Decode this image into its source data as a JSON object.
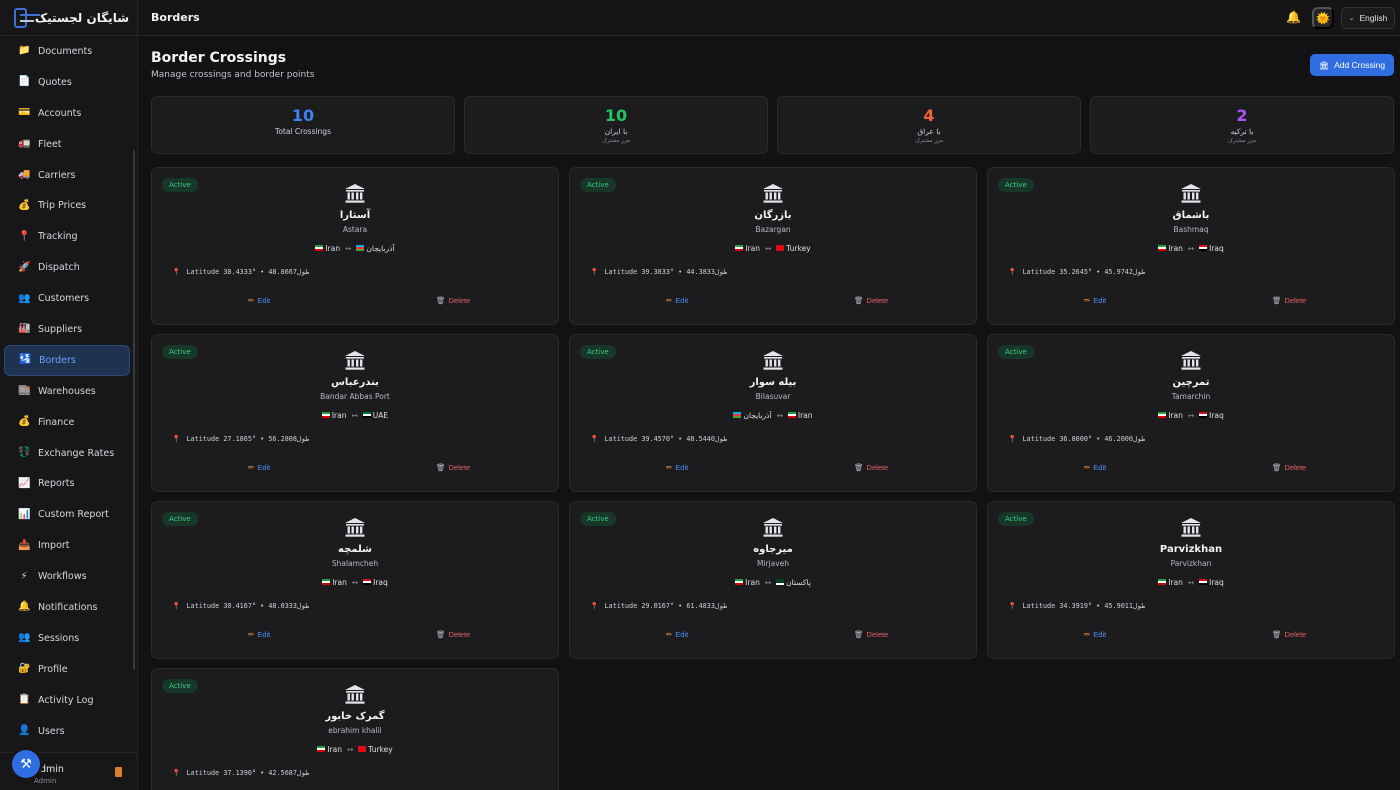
{
  "app": {
    "logo_text": "شایگان لجستیک"
  },
  "topbar": {
    "title": "Borders",
    "language": "English"
  },
  "sidebar": {
    "items": [
      {
        "label": "Documents",
        "icon": "folder-icon",
        "glyph": "📁"
      },
      {
        "label": "Quotes",
        "icon": "document-icon",
        "glyph": "📄"
      },
      {
        "label": "Accounts",
        "icon": "card-icon",
        "glyph": "💳"
      },
      {
        "label": "Fleet",
        "icon": "truck-icon",
        "glyph": "🚛"
      },
      {
        "label": "Carriers",
        "icon": "carrier-truck-icon",
        "glyph": "🚚"
      },
      {
        "label": "Trip Prices",
        "icon": "money-bag-icon",
        "glyph": "💰"
      },
      {
        "label": "Tracking",
        "icon": "pin-icon",
        "glyph": "📍"
      },
      {
        "label": "Dispatch",
        "icon": "rocket-icon",
        "glyph": "🚀"
      },
      {
        "label": "Customers",
        "icon": "people-icon",
        "glyph": "👥"
      },
      {
        "label": "Suppliers",
        "icon": "factory-icon",
        "glyph": "🏭"
      },
      {
        "label": "Borders",
        "icon": "passport-control-icon",
        "glyph": "🛂",
        "active": true
      },
      {
        "label": "Warehouses",
        "icon": "warehouse-icon",
        "glyph": "🏬"
      },
      {
        "label": "Finance",
        "icon": "coin-bag-icon",
        "glyph": "💰"
      },
      {
        "label": "Exchange Rates",
        "icon": "exchange-icon",
        "glyph": "💱"
      },
      {
        "label": "Reports",
        "icon": "chart-icon",
        "glyph": "📈"
      },
      {
        "label": "Custom Report",
        "icon": "bar-chart-icon",
        "glyph": "📊"
      },
      {
        "label": "Import",
        "icon": "inbox-icon",
        "glyph": "📥"
      },
      {
        "label": "Workflows",
        "icon": "lightning-icon",
        "glyph": "⚡"
      },
      {
        "label": "Notifications",
        "icon": "bell-icon",
        "glyph": "🔔"
      },
      {
        "label": "Sessions",
        "icon": "people-icon",
        "glyph": "👥"
      },
      {
        "label": "Profile",
        "icon": "lock-icon",
        "glyph": "🔐"
      },
      {
        "label": "Activity Log",
        "icon": "log-icon",
        "glyph": "📋"
      },
      {
        "label": "Users",
        "icon": "user-icon",
        "glyph": "👤"
      }
    ],
    "user": {
      "name": "dmin",
      "role": "Admin"
    }
  },
  "page": {
    "title": "Border Crossings",
    "subtitle": "Manage crossings and border points",
    "add_label": "Add Crossing"
  },
  "stats": [
    {
      "value": "10",
      "label": "Total Crossings",
      "sub": "",
      "color": "#3b82f6"
    },
    {
      "value": "10",
      "label": "با ایران",
      "sub": "مرز مشترک",
      "color": "#22c55e"
    },
    {
      "value": "4",
      "label": "با عراق",
      "sub": "مرز مشترک",
      "color": "#f0643c"
    },
    {
      "value": "2",
      "label": "با ترکیه",
      "sub": "مرز مشترک",
      "color": "#a855f7"
    }
  ],
  "card_labels": {
    "status": "Active",
    "edit": "Edit",
    "delete": "Delete",
    "arrow": "↔",
    "lat_prefix": "Latitude",
    "lon_suffix": "طول"
  },
  "crossings": [
    {
      "name_fa": "آستارا",
      "name_en": "Astara",
      "from": "Iran",
      "to": "آذربایجان",
      "lat": "38.4333°",
      "lon": "48.8667"
    },
    {
      "name_fa": "بازرگان",
      "name_en": "Bazargan",
      "from": "Iran",
      "to": "Turkey",
      "lat": "39.3833°",
      "lon": "44.3833"
    },
    {
      "name_fa": "باشماق",
      "name_en": "Bashmaq",
      "from": "Iran",
      "to": "Iraq",
      "lat": "35.2645°",
      "lon": "45.9742"
    },
    {
      "name_fa": "بندرعباس",
      "name_en": "Bandar Abbas Port",
      "from": "Iran",
      "to": "UAE",
      "lat": "27.1865°",
      "lon": "56.2808"
    },
    {
      "name_fa": "بیله سوار",
      "name_en": "Bilasuvar",
      "from": "آذربایجان",
      "to": "Iran",
      "lat": "39.4570°",
      "lon": "48.5440"
    },
    {
      "name_fa": "تمرچین",
      "name_en": "Tamarchin",
      "from": "Iran",
      "to": "Iraq",
      "lat": "36.8000°",
      "lon": "46.2000"
    },
    {
      "name_fa": "شلمچه",
      "name_en": "Shalamcheh",
      "from": "Iran",
      "to": "Iraq",
      "lat": "30.4167°",
      "lon": "48.0333"
    },
    {
      "name_fa": "میرجاوه",
      "name_en": "Mirjaveh",
      "from": "Iran",
      "to": "پاکستان",
      "lat": "29.0167°",
      "lon": "61.4833"
    },
    {
      "name_fa": "Parvizkhan",
      "name_en": "Parvizkhan",
      "from": "Iran",
      "to": "Iraq",
      "lat": "34.3919°",
      "lon": "45.9011"
    },
    {
      "name_fa": "گمرک خابور",
      "name_en": "ebrahim khalil",
      "from": "Iran",
      "to": "Turkey",
      "lat": "37.1390°",
      "lon": "42.5687"
    }
  ],
  "flags": {
    "Iran": [
      "#239f40",
      "#ffffff",
      "#da0000"
    ],
    "Iraq": [
      "#ce1126",
      "#ffffff",
      "#000000"
    ],
    "Turkey": [
      "#e30a17",
      "#e30a17",
      "#e30a17"
    ],
    "UAE": [
      "#00732f",
      "#ffffff",
      "#000000"
    ],
    "آذربایجان": [
      "#00b5e2",
      "#ef3340",
      "#509e2f"
    ],
    "پاکستان": [
      "#01411c",
      "#01411c",
      "#ffffff"
    ]
  }
}
